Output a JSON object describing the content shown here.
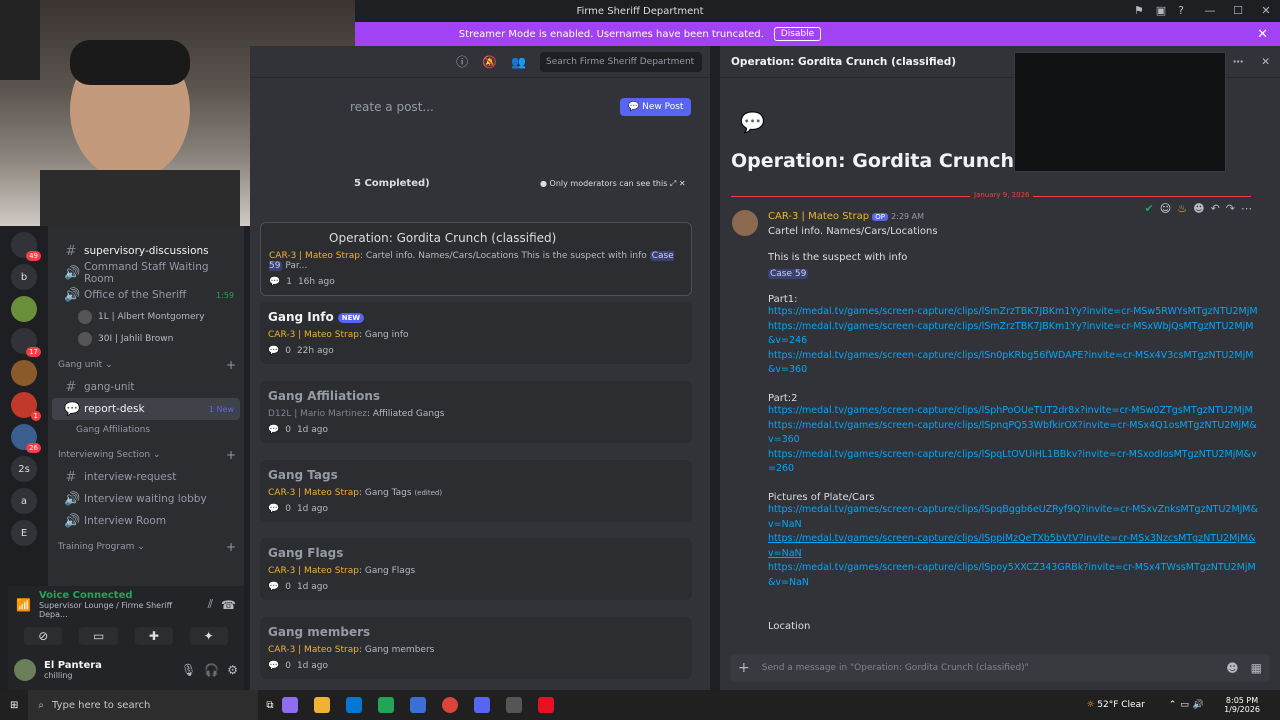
{
  "window": {
    "title": "Firme Sheriff Department"
  },
  "streamer_banner": {
    "text": "Streamer Mode is enabled. Usernames have been truncated.",
    "button": "Disable"
  },
  "guilds": [
    {
      "label": "",
      "badge": "49"
    },
    {
      "label": "b",
      "badge": ""
    },
    {
      "label": "",
      "badge": ""
    },
    {
      "label": "",
      "badge": "17"
    },
    {
      "label": "",
      "badge": ""
    },
    {
      "label": "",
      "badge": "1"
    },
    {
      "label": "",
      "badge": "26"
    },
    {
      "label": "2s",
      "badge": ""
    },
    {
      "label": "a",
      "badge": ""
    },
    {
      "label": "E",
      "badge": ""
    }
  ],
  "channels": {
    "supervisory": "supervisory-discussions",
    "command_staff": "Command Staff Waiting Room",
    "office": {
      "label": "Office of the Sheriff",
      "time": "1:59"
    },
    "voice_users": [
      "1L | Albert Montgomery",
      "30I | Jahlil Brown"
    ],
    "cat_gang": "Gang unit",
    "gang_unit": "gang-unit",
    "report_desk": {
      "label": "report-desk",
      "badge": "1 New"
    },
    "gang_affiliations": "Gang Affiliations",
    "cat_interview": "Interviewing Section",
    "interview_request": "interview-request",
    "interview_lobby": "Interview waiting lobby",
    "interview_room": "Interview Room",
    "cat_training": "Training Program"
  },
  "voice": {
    "status": "Voice Connected",
    "location": "Supervisor Lounge / Firme Sheriff Depa..."
  },
  "user": {
    "name": "El Pantera",
    "status": "chilling"
  },
  "forum": {
    "search_placeholder": "Search Firme Sheriff Department",
    "create_placeholder": "reate a post...",
    "new_post": "New Post",
    "completed": "5 Completed)",
    "mod_note": "Only moderators can see this",
    "posts": [
      {
        "title": "Operation: Gordita Crunch (classified)",
        "author": "CAR-3 | Mateo Strap",
        "preview": "Cartel info. Names/Cars/Locations This is the suspect with info",
        "tag": "Case 59",
        "suffix": "Par...",
        "count": "1",
        "time": "16h ago"
      },
      {
        "title": "Gang Info",
        "badge": "NEW",
        "author": "CAR-3 | Mateo Strap",
        "preview": "Gang info",
        "count": "0",
        "time": "22h ago"
      },
      {
        "title": "Gang Affiliations",
        "author": "D12L | Mario Martinez",
        "preview": "Affiliated Gangs",
        "count": "0",
        "time": "1d ago"
      },
      {
        "title": "Gang Tags",
        "author": "CAR-3 | Mateo Strap",
        "preview": "Gang Tags",
        "edited": "(edited)",
        "count": "0",
        "time": "1d ago"
      },
      {
        "title": "Gang Flags",
        "author": "CAR-3 | Mateo Strap",
        "preview": "Gang Flags",
        "count": "0",
        "time": "1d ago"
      },
      {
        "title": "Gang members",
        "author": "CAR-3 | Mateo Strap",
        "preview": "Gang members",
        "count": "0",
        "time": "1d ago"
      }
    ]
  },
  "thread": {
    "title": "Operation: Gordita Crunch (classified)",
    "big_title": "Operation: Gordita Crunch (cla",
    "date_divider": "January 9, 2026",
    "author": "CAR-3 | Mateo Strap",
    "op": "OP",
    "time": "2:29 AM",
    "line1": "Cartel info. Names/Cars/Locations",
    "line2": "This is the suspect with info",
    "tag": "Case 59",
    "part1": "Part1:",
    "part1_links": [
      "https://medal.tv/games/screen-capture/clips/lSmZrzTBK7JBKm1Yy?invite=cr-MSw5RWYsMTgzNTU2MjM",
      "https://medal.tv/games/screen-capture/clips/lSmZrzTBK7JBKm1Yy?invite=cr-MSxWbjQsMTgzNTU2MjM&v=246",
      "https://medal.tv/games/screen-capture/clips/lSn0pKRbg56fWDAPE?invite=cr-MSx4V3csMTgzNTU2MjM&v=360"
    ],
    "part2": "Part:2",
    "part2_links": [
      "https://medal.tv/games/screen-capture/clips/lSphPoOUeTUT2dr8x?invite=cr-MSw0ZTgsMTgzNTU2MjM",
      "https://medal.tv/games/screen-capture/clips/lSpnqPQ53WbfkirOX?invite=cr-MSx4Q1osMTgzNTU2MjM&v=360",
      "https://medal.tv/games/screen-capture/clips/lSpqLtOVUiHL1BBkv?invite=cr-MSxodlosMTgzNTU2MjM&v=260"
    ],
    "pics": "Pictures of Plate/Cars",
    "pic_links": [
      "https://medal.tv/games/screen-capture/clips/lSpqBggb6eUZRyf9Q?invite=cr-MSxvZnksMTgzNTU2MjM&v=NaN",
      "https://medal.tv/games/screen-capture/clips/lSppiMzQeTXb5bVtV?invite=cr-MSx3NzcsMTgzNTU2MjM&v=NaN",
      "https://medal.tv/games/screen-capture/clips/lSpoy5XXCZ343GRBk?invite=cr-MSx4TWssMTgzNTU2MjM&v=NaN"
    ],
    "location": "Location",
    "composer_placeholder": "Send a message in \"Operation: Gordita Crunch (classified)\""
  },
  "taskbar": {
    "search": "Type here to search",
    "weather": "52°F  Clear",
    "time": "8:05 PM",
    "date": "1/9/2026"
  },
  "colors": {
    "streamer": "#a142f4",
    "link": "#00a8fc",
    "accent": "#5865f2",
    "author": "#f0b232"
  }
}
